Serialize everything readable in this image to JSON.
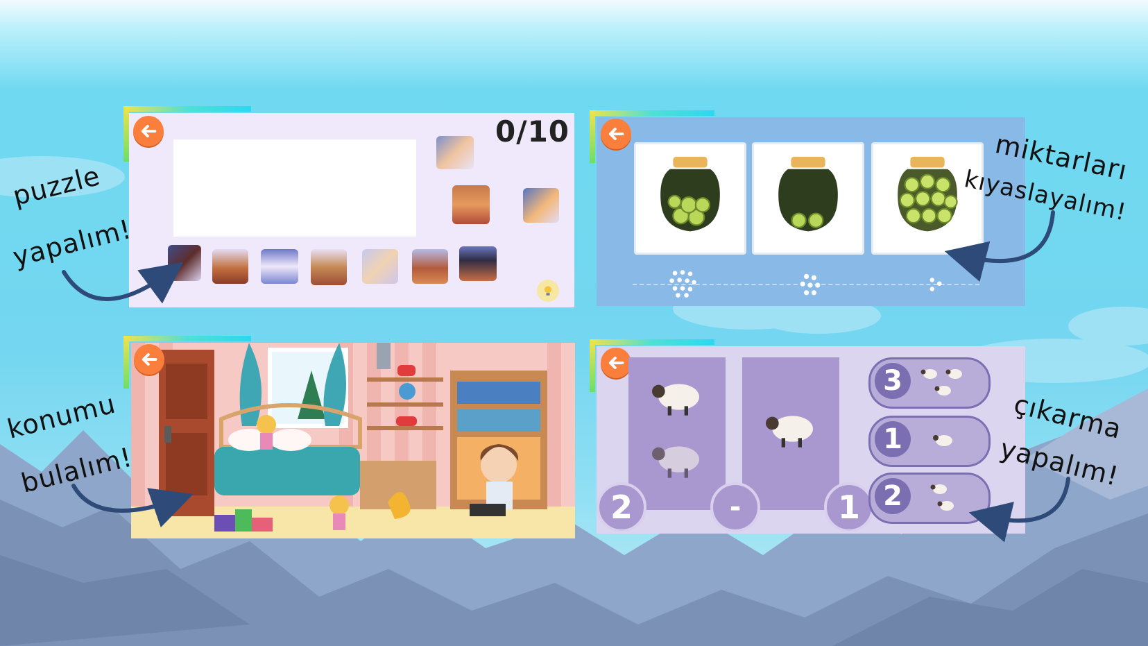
{
  "colors": {
    "accent_orange": "#fb7f3c",
    "puzzle_bg": "#f0e9fb",
    "compare_bg": "#89b9e6",
    "subtract_bg": "#dcd5f0",
    "arrow": "#2d4a78",
    "jar_dark": "#2f3d1f",
    "lid": "#e9b45a"
  },
  "callouts": {
    "puzzle": [
      "puzzle",
      "yapalım!"
    ],
    "compare": [
      "miktarları",
      "kıyaslayalım!"
    ],
    "locate": [
      "konumu",
      "bulalım!"
    ],
    "subtract": [
      "çıkarma",
      "yapalım!"
    ]
  },
  "puzzle_game": {
    "score": "0/10",
    "back_icon": "arrow-left-icon",
    "hint_icon": "lightbulb-icon"
  },
  "compare_game": {
    "back_icon": "arrow-left-icon",
    "jars": [
      {
        "fill": "full"
      },
      {
        "fill": "low"
      },
      {
        "fill": "many"
      }
    ],
    "dot_groups": [
      12,
      7,
      3
    ]
  },
  "locate_game": {
    "back_icon": "arrow-left-icon"
  },
  "subtract_game": {
    "back_icon": "arrow-left-icon",
    "left_value": "2",
    "operator": "-",
    "right_value": "1",
    "options": [
      {
        "label": "3",
        "sheep": 3
      },
      {
        "label": "1",
        "sheep": 1
      },
      {
        "label": "2",
        "sheep": 2
      }
    ]
  }
}
